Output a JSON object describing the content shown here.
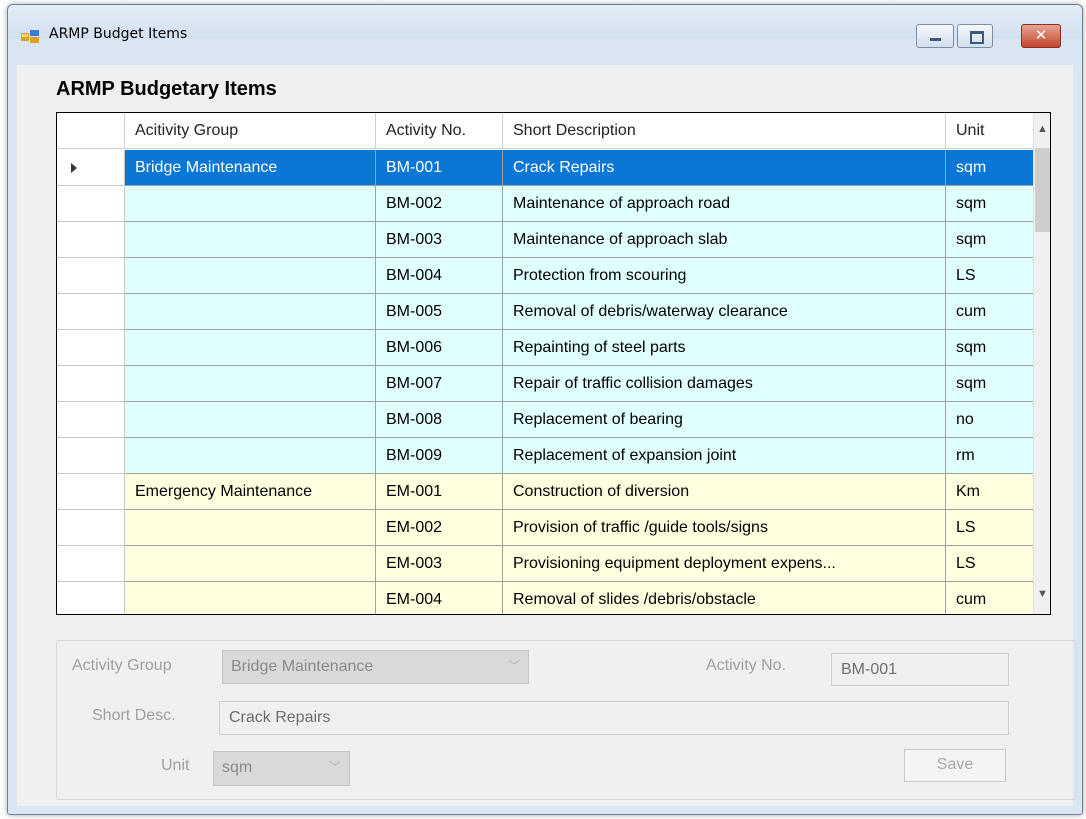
{
  "window": {
    "title": "ARMP Budget Items",
    "close_glyph": "✕"
  },
  "heading": "ARMP Budgetary Items",
  "grid": {
    "columns": [
      "Acitivity Group",
      "Activity No.",
      "Short Description",
      "Unit"
    ],
    "rows": [
      {
        "group": "Bridge Maintenance",
        "no": "BM-001",
        "desc": "Crack Repairs",
        "unit": "sqm",
        "selected": true
      },
      {
        "group": "",
        "no": "BM-002",
        "desc": "Maintenance of approach road",
        "unit": "sqm"
      },
      {
        "group": "",
        "no": "BM-003",
        "desc": "Maintenance of approach slab",
        "unit": "sqm"
      },
      {
        "group": "",
        "no": "BM-004",
        "desc": "Protection from scouring",
        "unit": "LS"
      },
      {
        "group": "",
        "no": "BM-005",
        "desc": "Removal of debris/waterway clearance",
        "unit": "cum"
      },
      {
        "group": "",
        "no": "BM-006",
        "desc": "Repainting of steel parts",
        "unit": "sqm"
      },
      {
        "group": "",
        "no": "BM-007",
        "desc": "Repair of traffic collision damages",
        "unit": "sqm"
      },
      {
        "group": "",
        "no": "BM-008",
        "desc": "Replacement of bearing",
        "unit": "no"
      },
      {
        "group": "",
        "no": "BM-009",
        "desc": "Replacement of expansion joint",
        "unit": "rm"
      },
      {
        "group": "Emergency Maintenance",
        "no": "EM-001",
        "desc": "Construction of diversion",
        "unit": "Km"
      },
      {
        "group": "",
        "no": "EM-002",
        "desc": "Provision of traffic /guide tools/signs",
        "unit": "LS"
      },
      {
        "group": "",
        "no": "EM-003",
        "desc": "Provisioning equipment deployment expens...",
        "unit": "LS"
      },
      {
        "group": "",
        "no": "EM-004",
        "desc": "Removal of slides /debris/obstacle",
        "unit": "cum"
      }
    ]
  },
  "form": {
    "activity_group_label": "Activity Group",
    "activity_group_value": "Bridge Maintenance",
    "activity_no_label": "Activity No.",
    "activity_no_value": "BM-001",
    "short_desc_label": "Short Desc.",
    "short_desc_value": "Crack Repairs",
    "unit_label": "Unit",
    "unit_value": "sqm",
    "save_label": "Save"
  },
  "colors": {
    "selected_row": "#0a77d6",
    "bridge_rows": "#e0ffff",
    "emergency_rows": "#ffffe0",
    "window_frame": "#dbe6f3"
  }
}
